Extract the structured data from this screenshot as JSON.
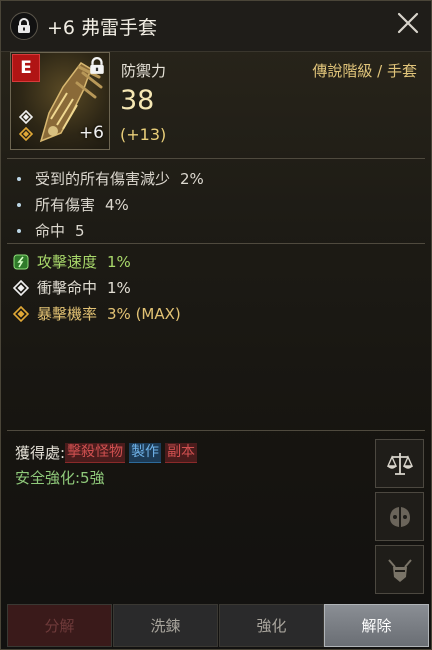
{
  "header": {
    "title": "+6 弗雷手套"
  },
  "item": {
    "grade_badge": "E",
    "enhance_level": "+6",
    "stat_label": "防禦力",
    "grade_text": "傳說階級 / 手套",
    "defense_value": "38",
    "defense_bonus": "(+13)"
  },
  "stats": [
    {
      "label": "受到的所有傷害減少",
      "value": "2%"
    },
    {
      "label": "所有傷害",
      "value": "4%"
    },
    {
      "label": "命中",
      "value": "5"
    }
  ],
  "enchants": [
    {
      "label": "攻擊速度",
      "value": "1%",
      "icon": "green-rune-icon",
      "color": "#a8d86a"
    },
    {
      "label": "衝擊命中",
      "value": "1%",
      "icon": "white-diamond-icon",
      "color": "#e2ded4"
    },
    {
      "label": "暴擊機率",
      "value": "3% (MAX)",
      "icon": "orange-diamond-icon",
      "color": "#e2c274"
    }
  ],
  "source": {
    "label": "獲得處:",
    "tags": [
      "擊殺怪物",
      "製作",
      "副本"
    ]
  },
  "safe_enhance": "安全強化:5強",
  "side_buttons": [
    "scale-icon",
    "split-mask-icon",
    "horned-helmet-icon"
  ],
  "actions": {
    "dismantle": "分解",
    "reroll": "洗鍊",
    "enhance": "強化",
    "unlock": "解除"
  },
  "colors": {
    "title": "#f2eee4",
    "grade": "#e0c47a",
    "defense": "#f6e8b4",
    "safe_enhance": "#8fc97a",
    "tag_red": "#d05050",
    "tag_blue": "#6fb2e8"
  }
}
